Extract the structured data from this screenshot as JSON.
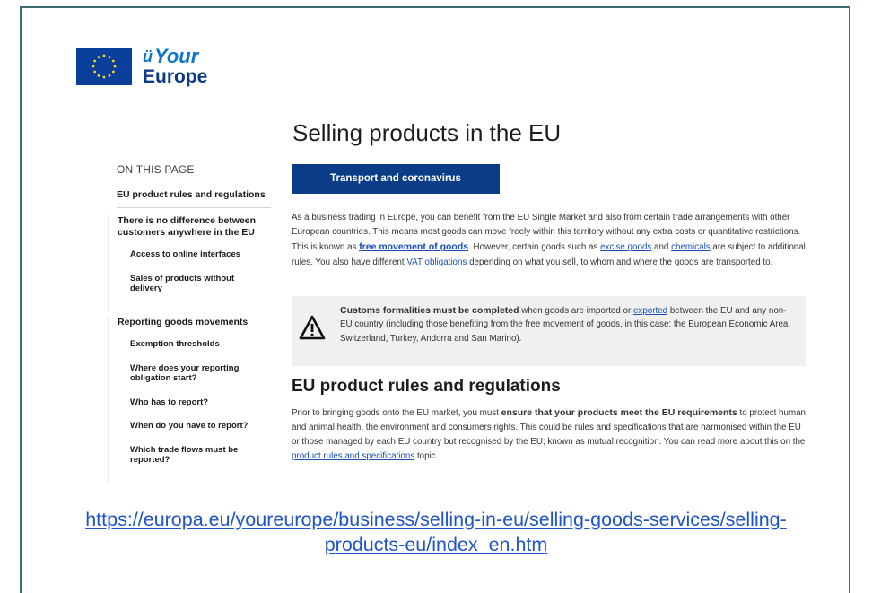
{
  "logo": {
    "your": "Your",
    "europe": "Europe"
  },
  "title": "Selling products in the EU",
  "sidebar": {
    "heading": "ON THIS PAGE",
    "first": "EU product rules and regulations",
    "group1": {
      "title": "There is no difference between customers anywhere in the EU",
      "items": [
        "Access to online interfaces",
        "Sales of products without delivery"
      ]
    },
    "group2": {
      "title": "Reporting goods movements",
      "items": [
        "Exemption thresholds",
        "Where does your reporting obligation start?",
        "Who has to report?",
        "When do you have to report?",
        "Which trade flows must be reported?"
      ]
    }
  },
  "main": {
    "button": "Transport and coronavirus",
    "intro": {
      "t1": "As a business trading in Europe, you can benefit from the EU Single Market and also from certain trade arrangements with other European countries. This means most goods can move freely within this territory without any extra costs or quantitative restrictions. This is known as ",
      "l1": "free movement of goods",
      "t2": ". However, certain goods such as ",
      "l2": "excise goods",
      "t3": " and ",
      "l3": "chemicals",
      "t4": " are subject to additional rules. You also have different ",
      "l4": "VAT obligations",
      "t5": " depending on what you sell, to whom and where the goods are transported to."
    },
    "alert": {
      "bold": "Customs formalities must be completed",
      "t1": " when goods are imported or ",
      "link": "exported",
      "t2": " between the EU and any non-EU country (including those benefiting from the free movement of goods, in this case: the European Economic Area, Switzerland, Turkey, Andorra and San Marino)."
    },
    "h2": "EU product rules and regulations",
    "p2": {
      "t1": "Prior to bringing goods onto the EU market, you must ",
      "bold": "ensure that your products meet the EU requirements",
      "t2": " to protect human and animal health, the environment and consumers rights. This could be rules and specifications that are harmonised within the EU or those managed by each EU country but recognised by the EU; known as mutual recognition. You can read more about this on the ",
      "link": "product rules and specifications",
      "t3": " topic."
    }
  },
  "url": "https://europa.eu/youreurope/business/selling-in-eu/selling-goods-services/selling-products-eu/index_en.htm",
  "colors": {
    "eu_blue": "#0b3c86",
    "link": "#1a4fb5",
    "frame": "#3a6e73"
  }
}
